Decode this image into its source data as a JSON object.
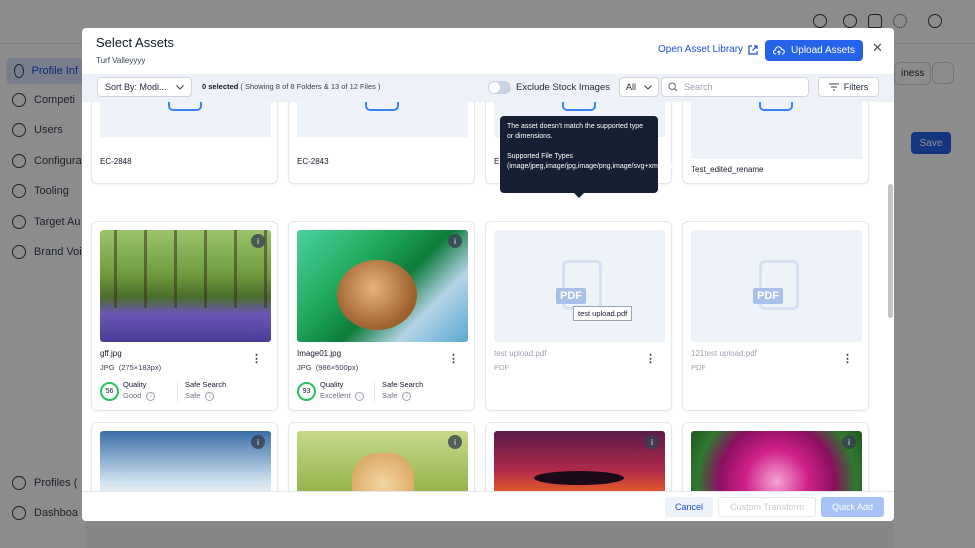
{
  "background": {
    "nav": [
      {
        "label": "Profile Inf",
        "active": true
      },
      {
        "label": "Competi"
      },
      {
        "label": "Users"
      },
      {
        "label": "Configura"
      },
      {
        "label": "Tooling"
      },
      {
        "label": "Target Au"
      },
      {
        "label": "Brand Voi"
      },
      {
        "label": "Profiles ("
      },
      {
        "label": "Dashboa"
      }
    ],
    "right_button": "iness",
    "save_label": "Save"
  },
  "modal": {
    "title": "Select Assets",
    "subtitle": "Turf Valleyyyy",
    "open_library": "Open Asset Library",
    "upload_label": "Upload Assets",
    "close": "✕"
  },
  "toolbar": {
    "sort_label": "Sort By: Modi...",
    "selected": "0 selected",
    "showing": "( Showing 8 of 8 Folders & 13 of 12 Files )",
    "exclude_label": "Exclude Stock Images",
    "type_filter": "All",
    "search_placeholder": "Search",
    "filters_label": "Filters"
  },
  "folders": [
    {
      "name": "EC-2848"
    },
    {
      "name": "EC-2843"
    },
    {
      "name": "E"
    },
    {
      "name": "Test_edited_rename"
    }
  ],
  "files": [
    {
      "name": "gff.jpg",
      "type": "JPG",
      "dims": "(275×183px)",
      "quality_score": "56",
      "quality_label": "Quality",
      "quality_value": "Good",
      "safe_label": "Safe Search",
      "safe_value": "Safe"
    },
    {
      "name": "Image01.jpg",
      "type": "JPG",
      "dims": "(986×500px)",
      "quality_score": "93",
      "quality_label": "Quality",
      "quality_value": "Excellent",
      "safe_label": "Safe Search",
      "safe_value": "Safe"
    },
    {
      "name": "test upload.pdf",
      "type": "PDF",
      "pdf_glyph": "PDF",
      "hover_label": "test upload.pdf"
    },
    {
      "name": "121test upload.pdf",
      "type": "PDF",
      "pdf_glyph": "PDF"
    }
  ],
  "tooltip": {
    "line1": "The asset doesn't match the supported type or dimensions.",
    "line2": "Supported File Types (image/jpeg,image/jpg,image/png,image/svg+xml,image/svg)"
  },
  "footer": {
    "cancel": "Cancel",
    "custom_transform": "Custom Transform",
    "quick_add": "Quick Add"
  },
  "colors": {
    "primary": "#2563eb",
    "quality_ring": "#22c55e",
    "tooltip_bg": "#172033"
  }
}
